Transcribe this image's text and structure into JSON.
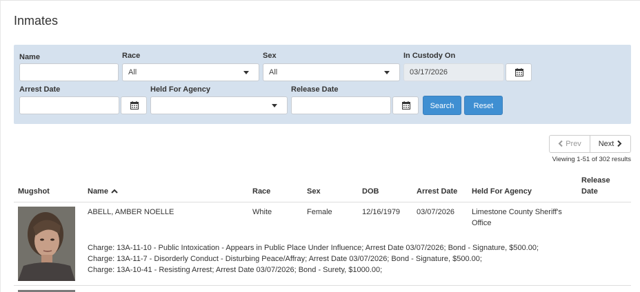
{
  "page": {
    "title": "Inmates"
  },
  "filters": {
    "name_label": "Name",
    "name_value": "",
    "race_label": "Race",
    "race_selected": "All",
    "sex_label": "Sex",
    "sex_selected": "All",
    "custody_label": "In Custody On",
    "custody_value": "03/17/2026",
    "arrest_label": "Arrest Date",
    "arrest_value": "",
    "agency_label": "Held For Agency",
    "agency_selected": "",
    "release_label": "Release Date",
    "release_value": "",
    "search_label": "Search",
    "reset_label": "Reset"
  },
  "pagination": {
    "prev_label": "Prev",
    "next_label": "Next",
    "viewing_text": "Viewing 1-51 of 302 results"
  },
  "table": {
    "headers": {
      "mugshot": "Mugshot",
      "name": "Name",
      "race": "Race",
      "sex": "Sex",
      "dob": "DOB",
      "arrest_date": "Arrest Date",
      "agency": "Held For Agency",
      "release_1": "Release",
      "release_2": "Date"
    },
    "rows": [
      {
        "name": "ABELL, AMBER NOELLE",
        "race": "White",
        "sex": "Female",
        "dob": "12/16/1979",
        "arrest_date": "03/07/2026",
        "agency_1": "Limestone County Sheriff's",
        "agency_2": "Office",
        "release_date": "",
        "charges": [
          "Charge: 13A-11-10 - Public Intoxication - Appears in Public Place Under Influence; Arrest Date 03/07/2026; Bond - Signature, $500.00;",
          "Charge: 13A-11-7 - Disorderly Conduct - Disturbing Peace/Affray; Arrest Date 03/07/2026; Bond - Signature, $500.00;",
          "Charge: 13A-10-41 - Resisting Arrest; Arrest Date 03/07/2026; Bond - Surety, $1000.00;"
        ]
      }
    ]
  },
  "icons": {
    "calendar": "calendar-icon",
    "caret": "caret-down-icon",
    "sort": "sort-ascending-icon",
    "prev": "chevron-left-icon",
    "next": "chevron-right-icon"
  },
  "colors": {
    "filter_bg": "#d5e1ee",
    "button_primary": "#3f8fd2"
  }
}
